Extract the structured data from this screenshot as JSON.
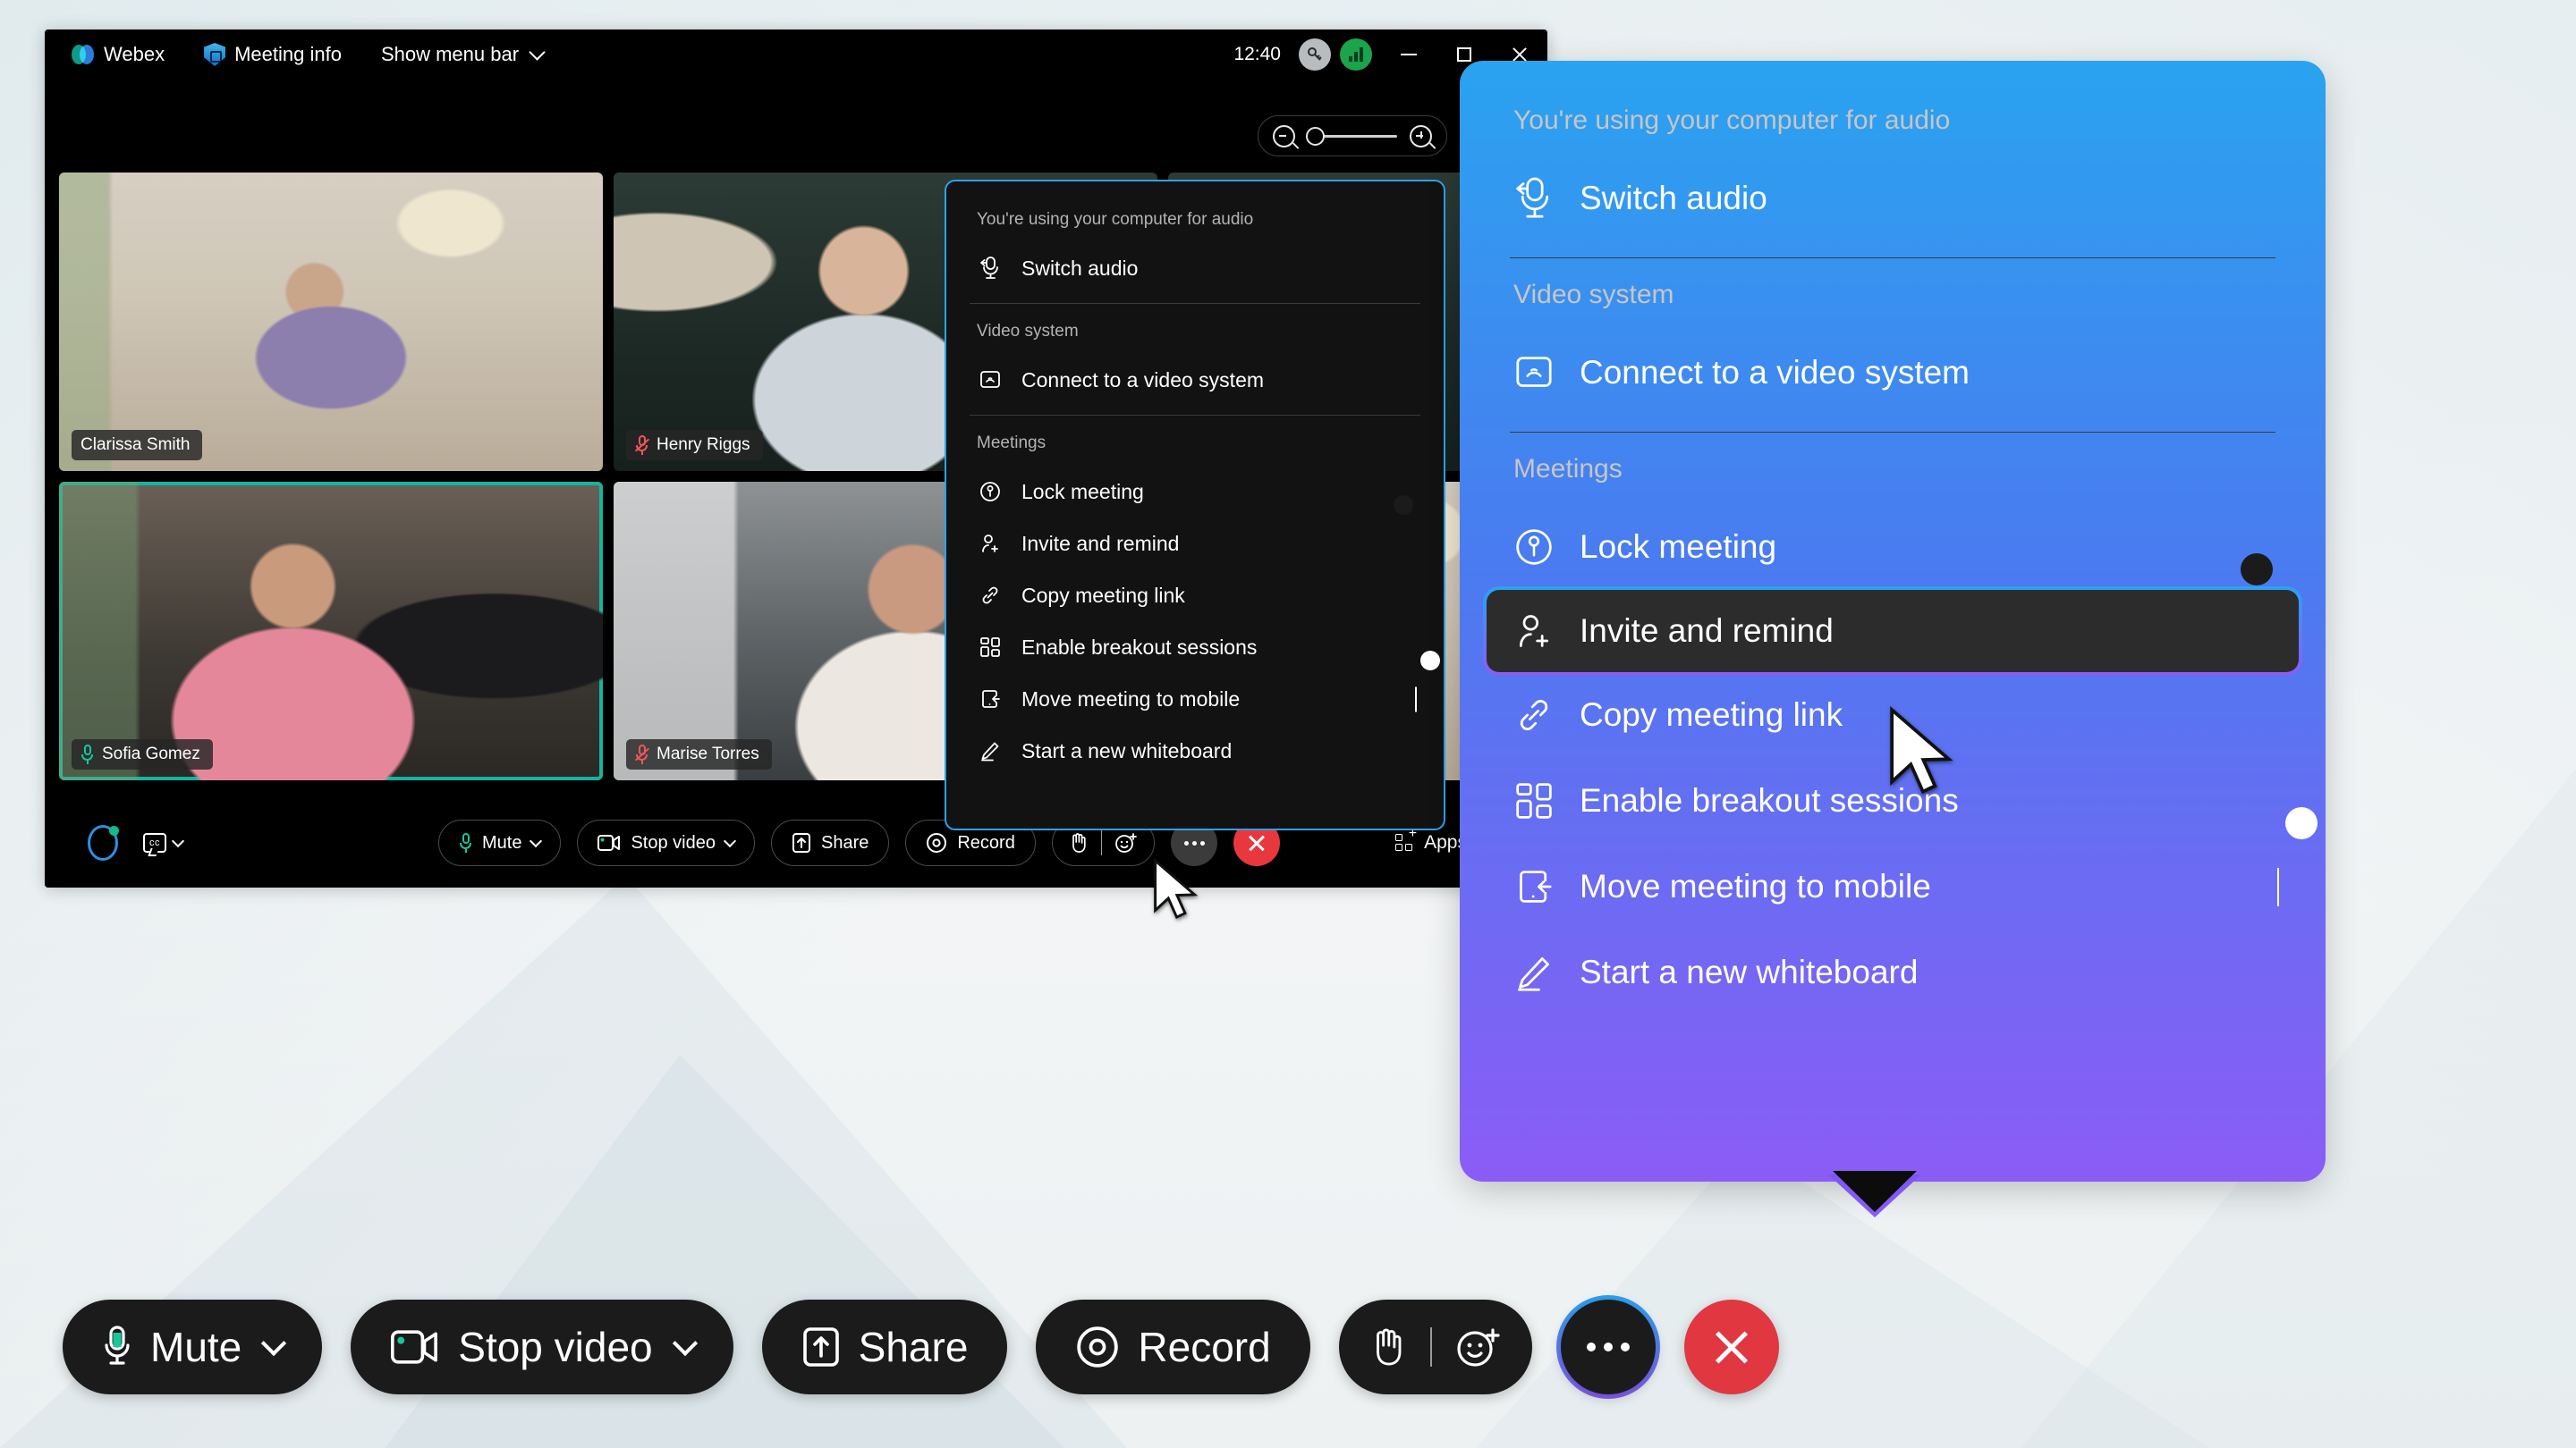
{
  "window": {
    "titlebar": {
      "app_name": "Webex",
      "meeting_info": "Meeting info",
      "show_menu_bar": "Show menu bar",
      "clock": "12:40",
      "app_icon": "webex-logo-icon",
      "meeting_info_icon": "shield-lock-icon",
      "menu_chevron_icon": "chevron-down-icon",
      "status_icon_1": "key-icon",
      "status_icon_2": "network-signal-icon",
      "minimize_icon": "minimize-icon",
      "maximize_icon": "maximize-icon",
      "close_icon": "close-icon"
    },
    "top_controls": {
      "zoom_out_icon": "zoom-out-icon",
      "zoom_in_icon": "zoom-in-icon",
      "layout_icon": "grid-layout-icon",
      "zoom_level": 0
    },
    "participants": [
      {
        "name": "Clarissa Smith",
        "mic": "unmuted",
        "active_speaker": false
      },
      {
        "name": "Henry Riggs",
        "mic": "muted",
        "active_speaker": false
      },
      {
        "name": "Sofia Gomez",
        "mic": "unmuted",
        "active_speaker": true
      },
      {
        "name": "Marise Torres",
        "mic": "muted",
        "active_speaker": false
      }
    ],
    "toolbar": {
      "assistant_icon": "webex-assistant-icon",
      "captions_icon": "closed-captions-icon",
      "captions_chevron_icon": "chevron-down-icon",
      "mute": "Mute",
      "mute_icon": "microphone-icon",
      "stop_video": "Stop video",
      "stop_video_icon": "camera-icon",
      "share": "Share",
      "share_icon": "share-screen-icon",
      "record": "Record",
      "record_icon": "record-icon",
      "raise_hand_icon": "raise-hand-icon",
      "reactions_icon": "reactions-smiley-icon",
      "more_icon": "more-options-icon",
      "end_icon": "end-meeting-icon",
      "apps": "Apps",
      "apps_icon": "apps-grid-icon",
      "participants_icon": "participants-icon"
    }
  },
  "menu": {
    "audio_status": "You're using your computer for audio",
    "switch_audio": {
      "label": "Switch audio",
      "icon": "switch-audio-icon"
    },
    "video_system_header": "Video system",
    "connect_video_system": {
      "label": "Connect to a video system",
      "icon": "video-system-icon"
    },
    "meetings_header": "Meetings",
    "items": [
      {
        "label": "Lock meeting",
        "icon": "lock-meeting-icon",
        "control": "toggle",
        "state": "on",
        "selected": false
      },
      {
        "label": "Invite and remind",
        "icon": "invite-person-icon",
        "control": "none",
        "selected": true
      },
      {
        "label": "Copy meeting link",
        "icon": "link-icon",
        "control": "none",
        "selected": false
      },
      {
        "label": "Enable breakout sessions",
        "icon": "breakout-sessions-icon",
        "control": "toggle",
        "state": "off",
        "selected": false
      },
      {
        "label": "Move meeting to mobile",
        "icon": "mobile-device-icon",
        "control": "submenu",
        "selected": false
      },
      {
        "label": "Start a new whiteboard",
        "icon": "pencil-whiteboard-icon",
        "control": "none",
        "selected": false
      }
    ]
  },
  "big_toolbar": {
    "mute": "Mute",
    "mute_icon": "microphone-icon",
    "mute_chevron_icon": "chevron-down-icon",
    "stop_video": "Stop video",
    "stop_video_icon": "camera-icon",
    "stop_video_chevron_icon": "chevron-down-icon",
    "share": "Share",
    "share_icon": "share-screen-icon",
    "record": "Record",
    "record_icon": "record-icon",
    "raise_hand_icon": "raise-hand-icon",
    "reactions_icon": "reactions-smiley-icon",
    "more_icon": "more-options-icon",
    "end_icon": "end-meeting-icon"
  },
  "colors": {
    "accent_blue": "#2aa3f0",
    "accent_purple": "#8b5cf6",
    "toggle_on": "#5ab0f7",
    "toggle_off": "#4a4a4a",
    "end_red": "#e03741",
    "active_speaker_green": "#12b5a0",
    "mic_on_green": "#16c79a",
    "mic_off_red": "#f2555a"
  }
}
